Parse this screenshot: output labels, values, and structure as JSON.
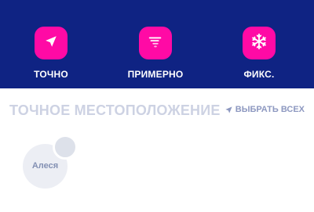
{
  "location_modes": [
    {
      "label": "ТОЧНО",
      "icon": "navigation-arrow-icon"
    },
    {
      "label": "ПРИМЕРНО",
      "icon": "blurred-arrow-icon"
    },
    {
      "label": "ФИКС.",
      "icon": "snowflake-icon"
    }
  ],
  "section": {
    "title": "ТОЧНОЕ МЕСТОПОЛОЖЕНИЕ",
    "select_all_label": "ВЫБРАТЬ ВСЕХ",
    "select_all_icon": "navigation-arrow-icon"
  },
  "contacts": [
    {
      "name": "Алеся"
    }
  ],
  "colors": {
    "header_background": "#0f2383",
    "accent_pink": "#ff0aa5",
    "section_title": "#cdd2e3",
    "select_all": "#8d98c0",
    "contact_bubble": "#eceef4",
    "contact_name": "#8390b3"
  }
}
